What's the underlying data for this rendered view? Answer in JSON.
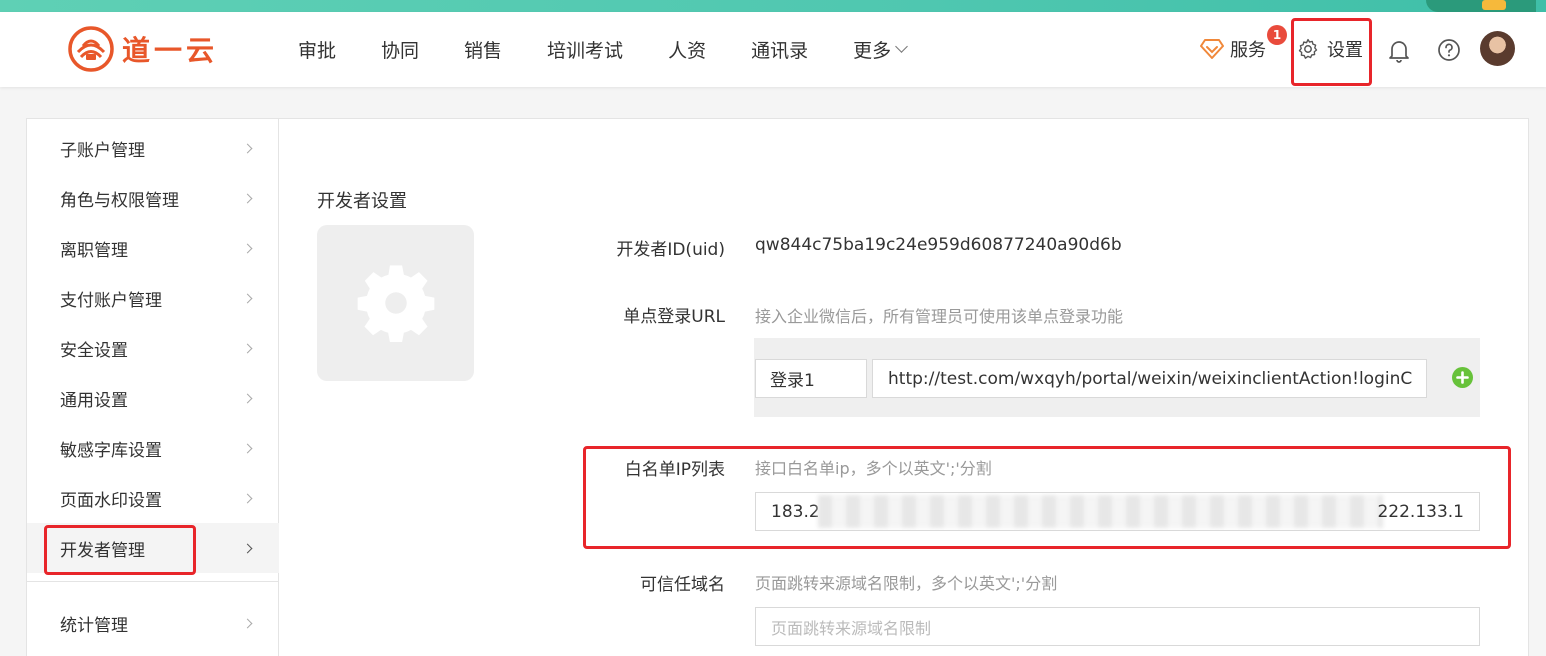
{
  "brand": {
    "name": "道一云",
    "color": "#e8572a"
  },
  "nav": {
    "items": [
      "审批",
      "协同",
      "销售",
      "培训考试",
      "人资",
      "通讯录"
    ],
    "more": "更多"
  },
  "header_tools": {
    "service": "服务",
    "badge_count": "1",
    "settings": "设置"
  },
  "sidebar": {
    "items": [
      "子账户管理",
      "角色与权限管理",
      "离职管理",
      "支付账户管理",
      "安全设置",
      "通用设置",
      "敏感字库设置",
      "页面水印设置",
      "开发者管理",
      "统计管理"
    ],
    "active": "开发者管理"
  },
  "content": {
    "title": "开发者设置",
    "developer_id_label": "开发者ID(uid)",
    "developer_id_value": "qw844c75ba19c24e959d60877240a90d6b",
    "sso_label": "单点登录URL",
    "sso_hint": "接入企业微信后，所有管理员可使用该单点登录功能",
    "sso_name_value": "登录1",
    "sso_url_value": "http://test.com/wxqyh/portal/weixin/weixinclientAction!loginC",
    "whitelist_label": "白名单IP列表",
    "whitelist_hint": "接口白名单ip，多个以英文';'分割",
    "whitelist_value_start": "183.2",
    "whitelist_value_end": "222.133.1",
    "domain_label": "可信任域名",
    "domain_hint": "页面跳转来源域名限制，多个以英文';'分割",
    "domain_placeholder": "页面跳转来源域名限制"
  },
  "colors": {
    "highlight_box": "#e8252a",
    "add_button": "#67c23a",
    "badge": "#e94b3c"
  }
}
